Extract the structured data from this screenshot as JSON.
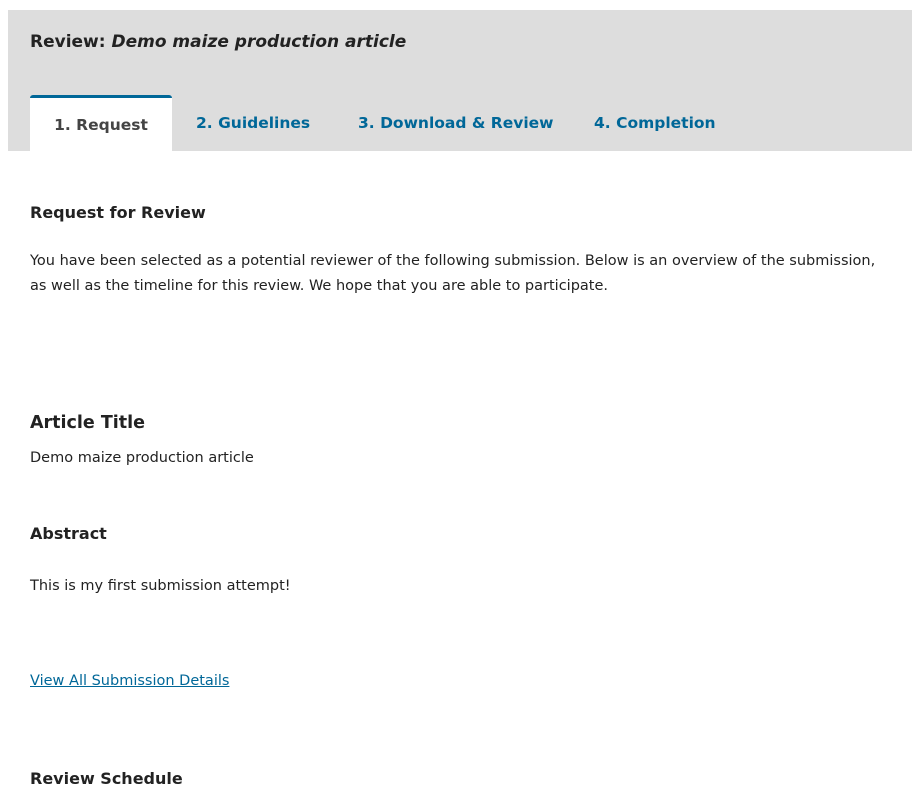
{
  "header": {
    "title_prefix": "Review: ",
    "title_submission": "Demo maize production article"
  },
  "tabs": [
    {
      "label": "1. Request",
      "active": true
    },
    {
      "label": "2. Guidelines",
      "active": false
    },
    {
      "label": "3. Download & Review",
      "active": false
    },
    {
      "label": "4. Completion",
      "active": false
    }
  ],
  "request": {
    "heading": "Request for Review",
    "intro": "You have been selected as a potential reviewer of the following submission. Below is an overview of the submission, as well as the timeline for this review. We hope that you are able to participate."
  },
  "article": {
    "title_label": "Article Title",
    "title_value": "Demo maize production article",
    "abstract_label": "Abstract",
    "abstract_value": "This is my first  submission attempt!"
  },
  "links": {
    "view_details": "View All Submission Details"
  },
  "schedule": {
    "heading": "Review Schedule"
  },
  "colors": {
    "accent": "#006798",
    "header_bg": "#dddddd",
    "text": "#222222"
  }
}
